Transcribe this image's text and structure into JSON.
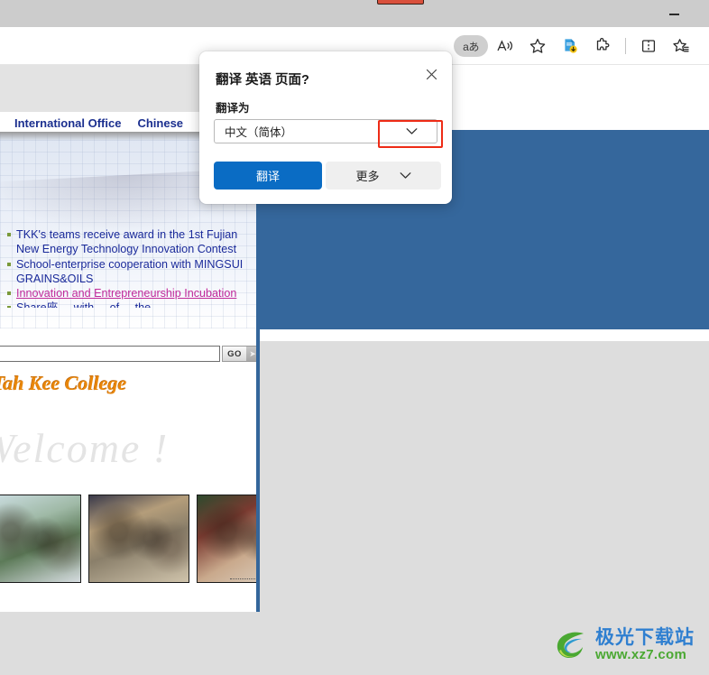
{
  "window": {
    "minimize_label": "—"
  },
  "toolbar": {
    "translate_icon_label": "aあ",
    "items": [
      {
        "name": "translate",
        "label": "aあ"
      },
      {
        "name": "read-aloud",
        "label": "A"
      },
      {
        "name": "favorite",
        "label": "☆"
      },
      {
        "name": "downloads",
        "label": ""
      },
      {
        "name": "extensions",
        "label": ""
      },
      {
        "name": "split-screen",
        "label": ""
      },
      {
        "name": "collections",
        "label": ""
      }
    ]
  },
  "dialog": {
    "title": "翻译 英语 页面?",
    "close_label": "✕",
    "sub_label": "翻译为",
    "selected_language": "中文（简体）",
    "translate_button": "翻译",
    "more_button": "更多",
    "accent_color": "#0a6cc4",
    "highlight_color": "#ee2b16"
  },
  "webpage": {
    "nav": [
      "International Office",
      "Chinese"
    ],
    "news": [
      "TKK's teams receive award in the 1st Fujian New Energy Technology Innovation Contest",
      "School-enterprise cooperation with MINGSUI GRAINS&OILS",
      "Innovation and Entrepreneurship Incubation",
      "Share座 ... with ... of ... the"
    ],
    "college_logo_text": "Tah Kee College",
    "search_placeholder": "",
    "search_value": "",
    "go_button": "GO",
    "go_arrow": "➤",
    "welcome_text": "Welcome !",
    "link_color": "#1a2a9a",
    "visited_link_color": "#c0299a",
    "panel_color": "#35679c"
  },
  "watermark": {
    "brand": "极光下载站",
    "url": "www.xz7.com",
    "brand_color": "#2f7fd0",
    "url_color": "#4aa832"
  }
}
